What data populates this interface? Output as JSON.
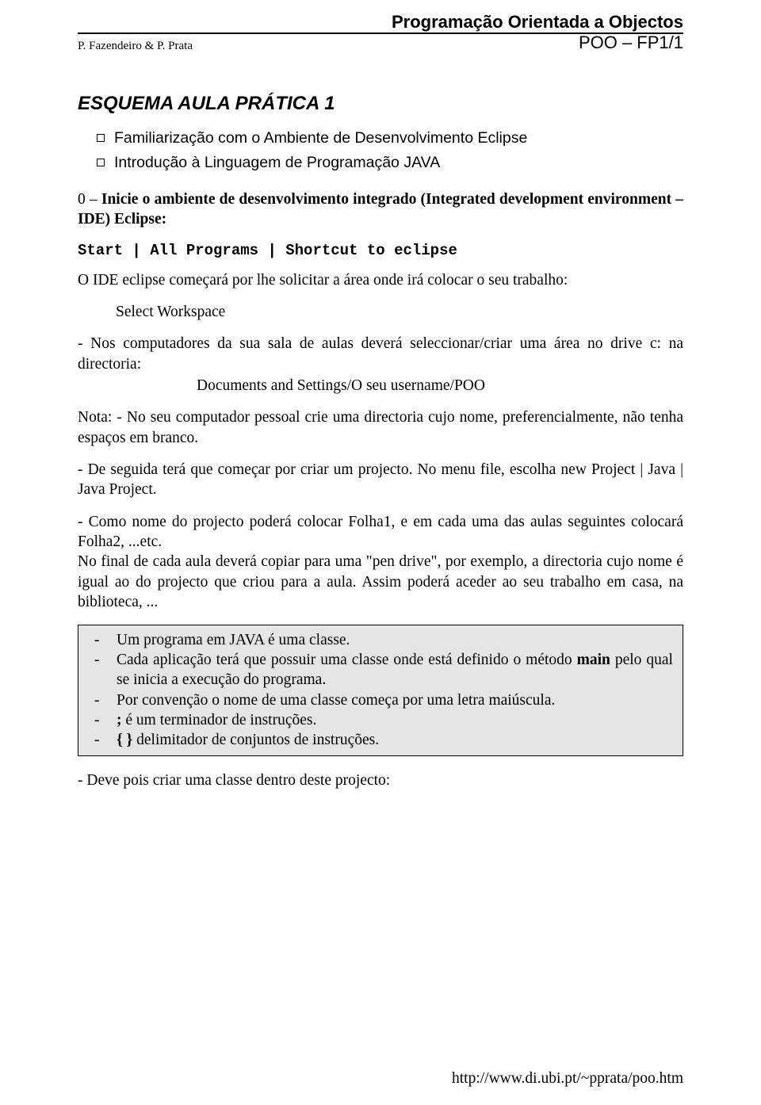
{
  "header": {
    "course": "Programação Orientada a Objectos",
    "authors": "P. Fazendeiro & P. Prata",
    "code": "POO – FP1/1"
  },
  "title": "ESQUEMA AULA PRÁTICA 1",
  "bullets": [
    "Familiarização com o Ambiente de Desenvolvimento Eclipse",
    "Introdução à Linguagem de Programação JAVA"
  ],
  "intro_line": "0 – Inicie o ambiente de desenvolvimento integrado (Integrated development environment – IDE) Eclipse:",
  "mono_line": "Start | All Programs | Shortcut to eclipse",
  "ide_line": "O IDE eclipse começará por lhe solicitar a área onde irá colocar o seu trabalho:",
  "select_workspace": "Select Workspace",
  "para_computadores": "- Nos computadores da sua sala de aulas deverá seleccionar/criar uma área no drive c: na directoria:",
  "doc_path": "Documents and Settings/O seu username/POO",
  "nota": "Nota: - No seu computador pessoal crie uma directoria cujo nome, preferencialmente, não tenha espaços em branco.",
  "proj_line": "- De seguida terá que começar por criar um projecto. No menu file, escolha new Project | Java | Java Project.",
  "folha_line": "- Como nome do projecto poderá colocar Folha1, e em cada uma das aulas seguintes colocará Folha2, ...etc.",
  "pendrive_line": "No final de cada aula deverá copiar para uma \"pen drive\", por exemplo, a directoria cujo nome é igual ao do projecto que criou para a aula. Assim poderá aceder ao seu trabalho em casa, na biblioteca, ...",
  "box": {
    "item1": "Um programa em JAVA é uma classe.",
    "item2_pre": "Cada aplicação terá que possuir uma classe onde está definido o método ",
    "item2_bold": "main",
    "item2_post": " pelo qual se inicia a execução do programa.",
    "item3": "Por convenção o nome de uma classe começa por uma letra maiúscula.",
    "item4_pre": ";",
    "item4_post": "  é um terminador de instruções.",
    "item5_pre": "{ }",
    "item5_post": " delimitador de conjuntos de instruções."
  },
  "final_line": "- Deve pois criar uma classe dentro deste projecto:",
  "footer": "http://www.di.ubi.pt/~pprata/poo.htm"
}
